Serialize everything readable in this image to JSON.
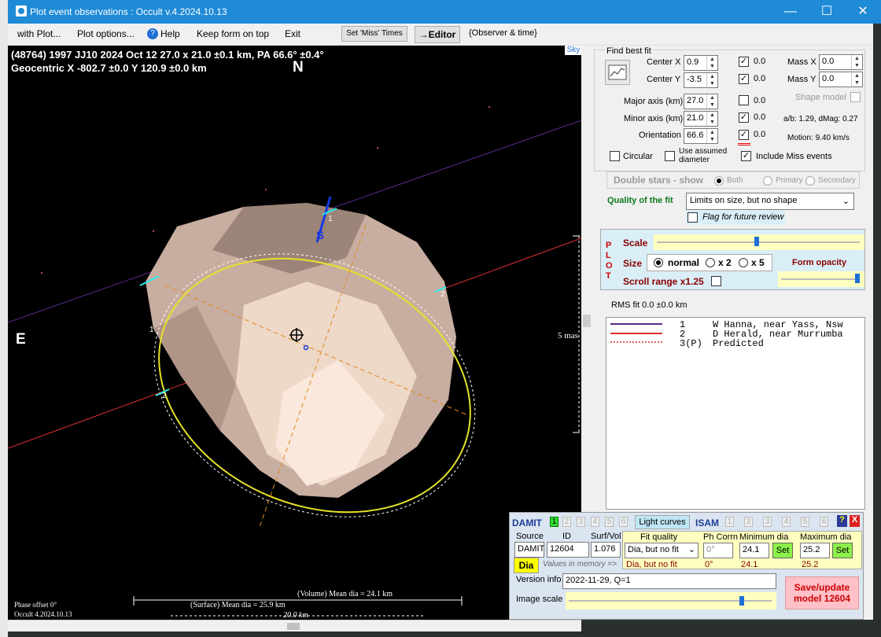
{
  "window": {
    "title": "Plot event observations : Occult v.4.2024.10.13",
    "minimize": "—",
    "maximize": "☐",
    "close": "✕"
  },
  "menu": {
    "with_plot": "with Plot...",
    "plot_options": "Plot options...",
    "help": "Help",
    "keep_on_top": "Keep form on top",
    "exit": "Exit",
    "set_miss": "Set 'Miss' Times",
    "editor": "→Editor",
    "observer_time": "{Observer & time}"
  },
  "plot": {
    "line1": "(48764) 1997 JJ10  2024 Oct 12  27.0 x 21.0 ±0.1 km,  PA 66.6° ±0.4°",
    "line2": "Geocentric  X  -802.7 ±0.0  Y  120.9 ±0.0 km",
    "north": "N",
    "east": "E",
    "sky": "Sky",
    "scale_label": "5 mas",
    "chord1": "1",
    "chord2": "2",
    "chord_s": "S",
    "volume_dia": "(Volume) Mean dia = 24.1 km",
    "surface_dia": "(Surface) Mean dia = 25.9 km",
    "scale_bar": "20.0 km",
    "phase": "Phase offset 0°",
    "version": "Occult 4.2024.10.13",
    "predicted": "Predicted"
  },
  "fit": {
    "header": "Find best fit",
    "center_x_label": "Center X",
    "center_x": "0.9",
    "center_y_label": "Center Y",
    "center_y": "-3.5",
    "major_label": "Major axis (km)",
    "major": "27.0",
    "minor_label": "Minor axis (km)",
    "minor": "21.0",
    "orient_label": "Orientation",
    "orient": "66.6",
    "d_cx": "0.0",
    "d_cy": "0.0",
    "d_major": "0.0",
    "d_minor": "0.0",
    "d_orient": "0.0",
    "mass_x_label": "Mass X",
    "mass_x": "0.0",
    "mass_y_label": "Mass Y",
    "mass_y": "0.0",
    "shape_model": "Shape model",
    "ab": "a/b: 1.29, dMag: 0.27",
    "motion": "Motion: 9.40 km/s",
    "circular": "Circular",
    "assumed": "Use assumed diameter",
    "include_miss": "Include Miss events",
    "double_stars": "Double stars - show",
    "both": "Both",
    "primary": "Primary",
    "secondary": "Secondary",
    "quality_label": "Quality of the fit",
    "quality": "Limits on size, but no shape",
    "flag": "Flag for future review"
  },
  "plotpanel": {
    "vert": "P L O T",
    "scale": "Scale",
    "size": "Size",
    "normal": "normal",
    "x2": "x 2",
    "x5": "x 5",
    "form_opacity": "Form opacity",
    "scroll": "Scroll range x1.25"
  },
  "rms": "RMS fit 0.0 ±0.0 km",
  "legend": [
    {
      "num": "1",
      "name": "W Hanna, near Yass, Nsw",
      "color": "#5b2a8a"
    },
    {
      "num": "2",
      "name": "D Herald, near Murrumba",
      "color": "#e03030"
    },
    {
      "num": "3(P)",
      "name": "Predicted",
      "color": "#e06060"
    }
  ],
  "damit": {
    "damit": "DAMIT",
    "nums": [
      "1",
      "2",
      "3",
      "4",
      "5",
      "6"
    ],
    "light_curves": "Light curves",
    "isam": "ISAM",
    "isam_nums": [
      "1",
      "2",
      "3",
      "4",
      "5",
      "6"
    ],
    "help": "?",
    "close": "X",
    "source_label": "Source",
    "id_label": "ID",
    "surf_label": "Surf/Vol",
    "source": "DAMIT",
    "id": "12604",
    "surf": "1.076",
    "fitq_label": "Fit quality",
    "ph_label": "Ph Corrn",
    "min_label": "Minimum dia",
    "max_label": "Maximum dia",
    "fitq": "Dia, but no fit",
    "ph": "0°",
    "min": "24.1",
    "max": "25.2",
    "set": "Set",
    "dia": "Dia",
    "mem": "Values in memory =>",
    "fitq_m": "Dia, but no fit",
    "ph_m": "0°",
    "min_m": "24.1",
    "max_m": "25.2",
    "version_label": "Version info",
    "version": "2022-11-29, Q=1",
    "image_scale": "Image scale",
    "save": "Save/update model 12604"
  }
}
